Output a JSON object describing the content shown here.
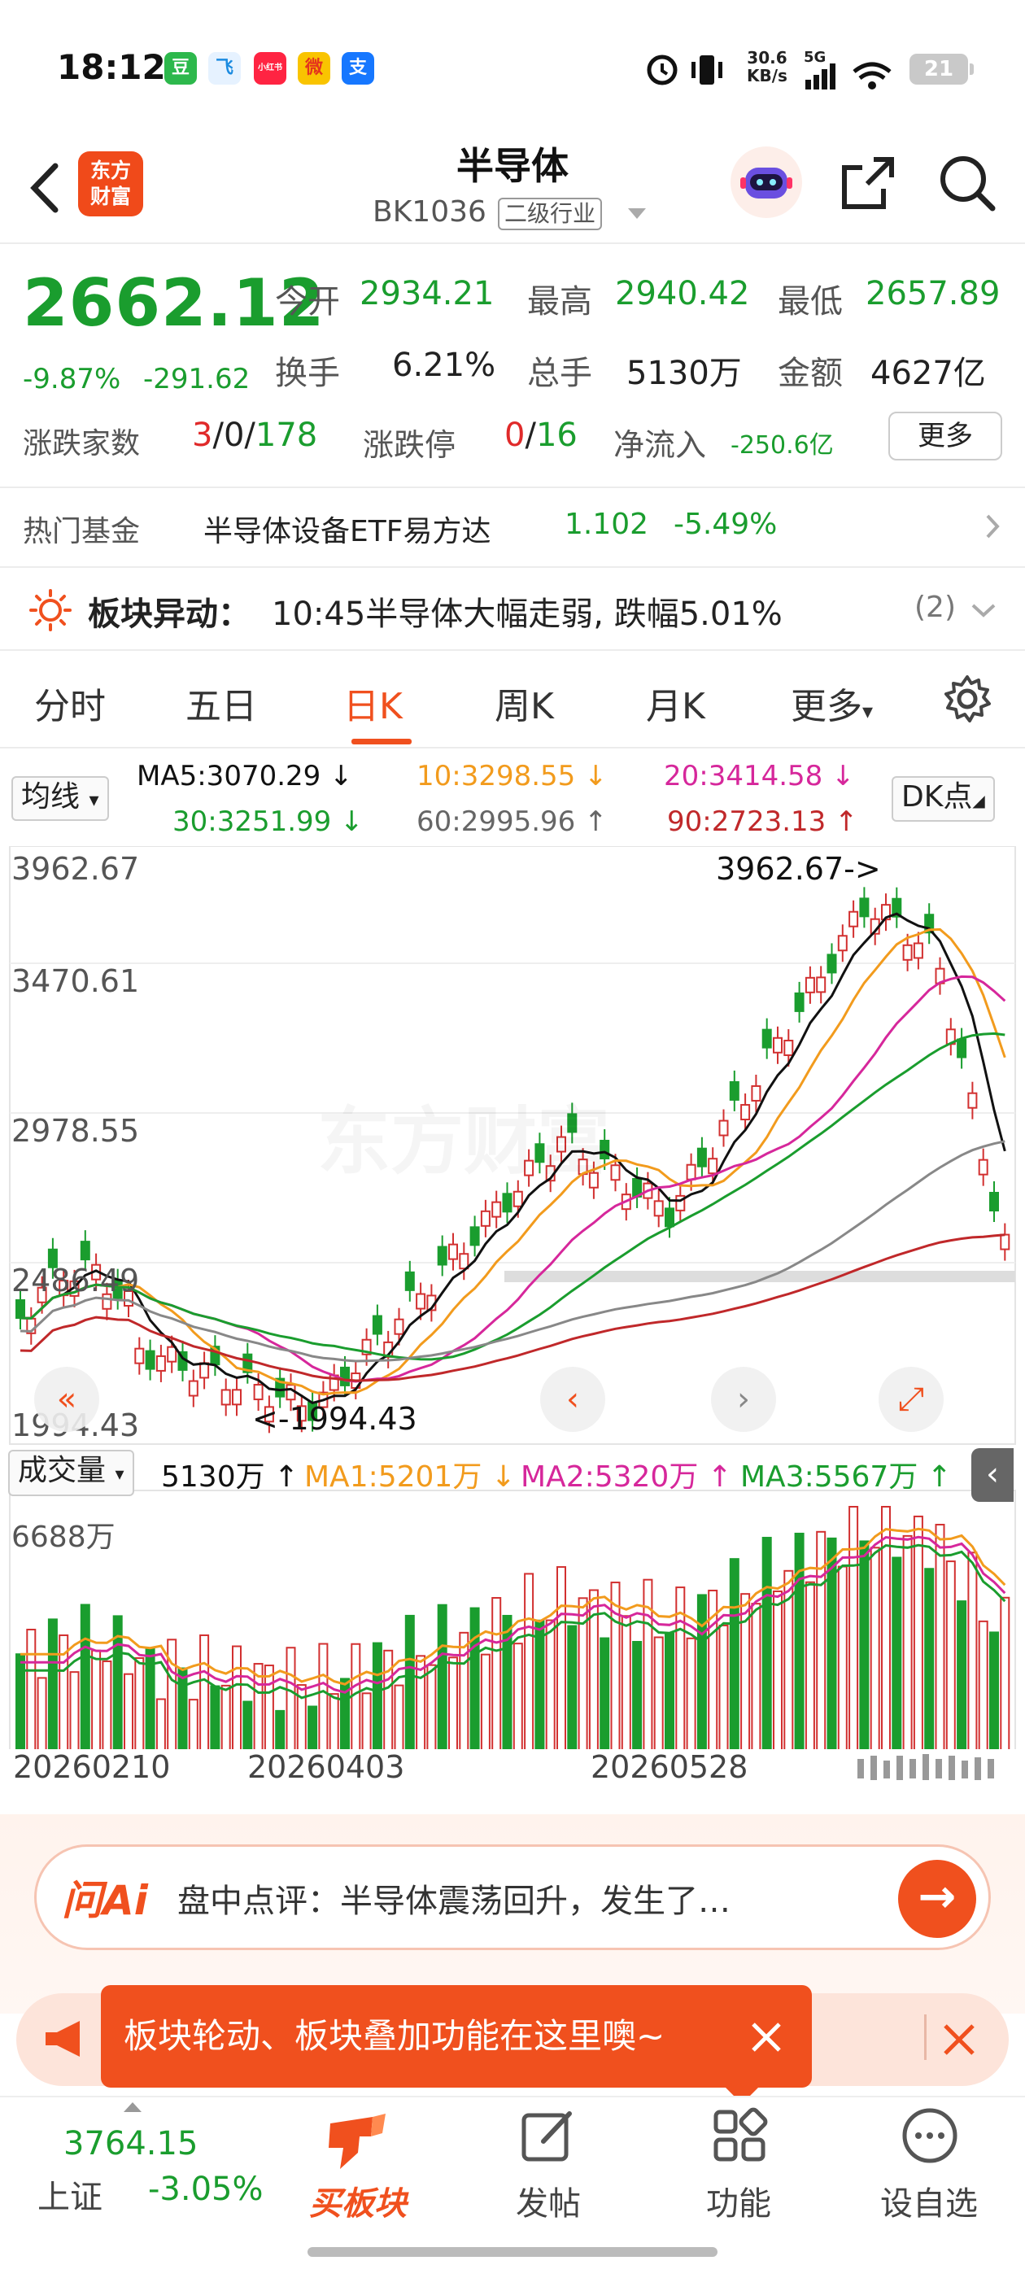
{
  "status_bar": {
    "time": "18:12",
    "app_icons": [
      "豆",
      "飞",
      "小红书",
      "微",
      "支"
    ],
    "net_speed": "30.6",
    "net_unit": "KB/s",
    "signal": "5G",
    "battery": "21"
  },
  "header": {
    "title": "半导体",
    "code": "BK1036",
    "level": "二级行业",
    "brand": "东方财富"
  },
  "quote": {
    "price": "2662.12",
    "change_pct": "-9.87%",
    "change_abs": "-291.62",
    "open_label": "今开",
    "open": "2934.21",
    "high_label": "最高",
    "high": "2940.42",
    "low_label": "最低",
    "low": "2657.89",
    "turnover_label": "换手",
    "turnover": "6.21%",
    "volume_label": "总手",
    "volume": "5130万",
    "amount_label": "金额",
    "amount": "4627亿",
    "breadth_label": "涨跌家数",
    "breadth_up": "3",
    "breadth_flat": "0",
    "breadth_down": "178",
    "limit_label": "涨跌停",
    "limit_up": "0",
    "limit_down": "16",
    "inflow_label": "净流入",
    "inflow": "-250.6亿",
    "more": "更多"
  },
  "hot_fund": {
    "label": "热门基金",
    "name": "半导体设备ETF易方达",
    "price": "1.102",
    "pct": "-5.49%"
  },
  "alert": {
    "label": "板块异动：",
    "text": "10:45半导体大幅走弱, 跌幅5.01%",
    "count": "(2)"
  },
  "tabs": [
    "分时",
    "五日",
    "日K",
    "周K",
    "月K",
    "更多"
  ],
  "active_tab": "日K",
  "ma": {
    "selector": "均线",
    "ma5": "MA5:3070.29 ↓",
    "ma10": "10:3298.55 ↓",
    "ma20": "20:3414.58 ↓",
    "ma30": "30:3251.99 ↓",
    "ma60": "60:2995.96 ↑",
    "ma90": "90:2723.13 ↑",
    "dk": "DK点",
    "colors": {
      "ma5": "#111111",
      "ma10": "#f29b1d",
      "ma20": "#d6279b",
      "ma30": "#1a9d2e",
      "ma60": "#777777",
      "ma90": "#c0282a"
    }
  },
  "kline": {
    "y_labels": [
      "3962.67",
      "3470.61",
      "2978.55",
      "2486.49",
      "1994.43"
    ],
    "high_marker": "3962.67->",
    "low_marker": "<-1994.43",
    "ylim": [
      1994.43,
      3962.67
    ],
    "watermark": "东方财富"
  },
  "volume": {
    "selector": "成交量",
    "current": "5130万 ↑",
    "ma1": "MA1:5201万 ↓",
    "ma2": "MA2:5320万 ↑",
    "ma3": "MA3:5567万 ↑",
    "max_label": "6688万",
    "dates": [
      "20260210",
      "20260403",
      "20260528"
    ]
  },
  "ai": {
    "logo": "问Ai",
    "text": "盘中点评：半导体震荡回升，发生了…"
  },
  "toast": {
    "text": "板块轮动、板块叠加功能在这里噢~"
  },
  "bottom_nav": {
    "index_value": "3764.15",
    "index_name": "上证",
    "index_pct": "-3.05%",
    "buy": "买板块",
    "post": "发帖",
    "func": "功能",
    "watch": "设自选"
  }
}
